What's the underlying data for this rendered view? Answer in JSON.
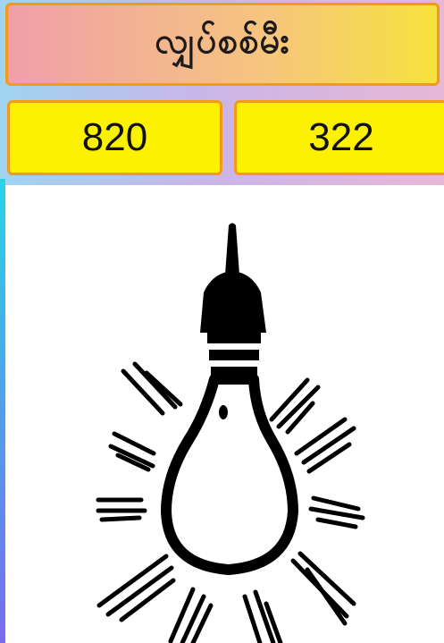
{
  "title": "လျှပ်စစ်မီး",
  "numbers": {
    "left": "820",
    "right": "322"
  },
  "image": {
    "icon": "light-bulb-icon"
  },
  "colors": {
    "title_border": "#f29a1c",
    "number_box_bg": "#fbf100"
  }
}
